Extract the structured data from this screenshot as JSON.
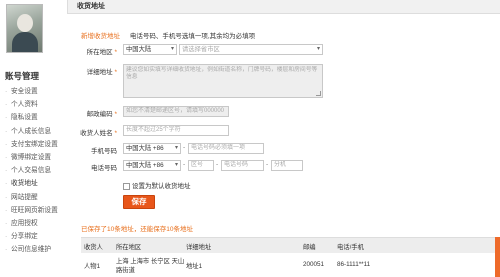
{
  "sidebar": {
    "title": "账号管理",
    "items": [
      "安全设置",
      "个人资料",
      "隐私设置",
      "个人成长信息",
      "支付宝绑定设置",
      "微博绑定设置",
      "个人交易信息",
      "收货地址",
      "网站提醒",
      "旺旺网页新设置",
      "应用授权",
      "分享绑定",
      "公司信息维护"
    ]
  },
  "tab": {
    "label": "收货地址"
  },
  "form": {
    "new_address_label": "新增收货地址",
    "tip": "电话号码、手机号选填一项,其余均为必填项",
    "region_label": "所在地区",
    "country_value": "中国大陆",
    "region_placeholder": "请选择省市区",
    "detail_label": "详细地址",
    "detail_placeholder": "建议您如实填写详细收货地址，例如街道名称，门牌号码，楼层和房间号等信息",
    "zip_label": "邮政编码",
    "zip_placeholder": "如您不清楚邮递区号，请填写000000",
    "name_label": "收货人姓名",
    "name_placeholder": "长度不超过25个字符",
    "mobile_label": "手机号码",
    "mobile_country": "中国大陆 +86",
    "mobile_placeholder": "电话号码必须填一项",
    "phone_label": "电话号码",
    "phone_country": "中国大陆 +86",
    "area_placeholder": "区号",
    "number_placeholder": "电话号码",
    "ext_placeholder": "分机",
    "default_label": "设置为默认收货地址",
    "save_label": "保存"
  },
  "summary": "已保存了10条地址，还能保存10条地址",
  "table": {
    "headers": [
      "收货人",
      "所在地区",
      "详细地址",
      "邮编",
      "电话/手机"
    ],
    "rows": [
      {
        "name": "人物1",
        "region_line1": "上海 上海市 长宁区 天山",
        "region_line2": "路街道",
        "detail": "地址1",
        "zip": "200051",
        "phone": "86-1111**11"
      }
    ]
  },
  "colors": {
    "accent": "#e8561a",
    "highlight": "#e8701e",
    "tab_bg": "#f1f1f1"
  }
}
